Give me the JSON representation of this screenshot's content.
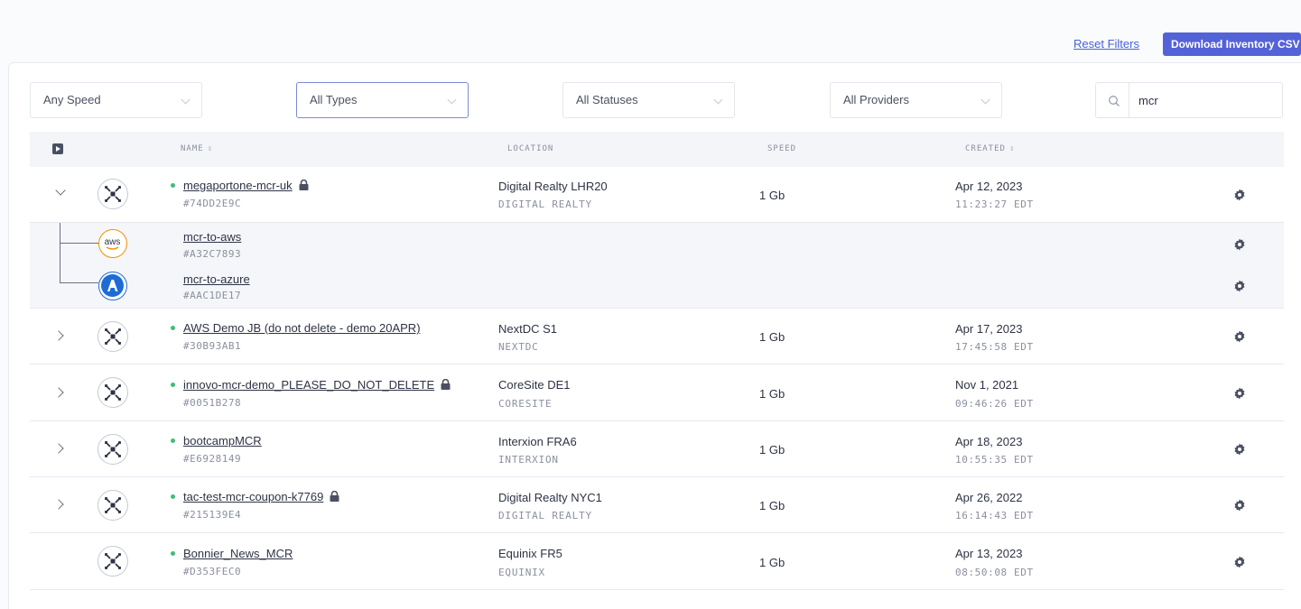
{
  "toolbar": {
    "reset_filters": "Reset Filters",
    "download_csv": "Download Inventory CSV"
  },
  "filters": {
    "speed": "Any Speed",
    "type": "All Types",
    "status": "All Statuses",
    "provider": "All Providers",
    "search_value": "mcr"
  },
  "table": {
    "headers": {
      "name": "NAME",
      "location": "LOCATION",
      "speed": "SPEED",
      "created": "CREATED"
    },
    "rows": [
      {
        "name": "megaportone-mcr-uk",
        "uid": "#74DD2E9C",
        "locked": true,
        "location": "Digital Realty LHR20",
        "provider": "DIGITAL REALTY",
        "speed": "1 Gb",
        "date": "Apr 12, 2023",
        "time": "11:23:27 EDT",
        "expanded": true,
        "children": [
          {
            "name": "mcr-to-aws",
            "uid": "#A32C7893",
            "icon": "aws-icon"
          },
          {
            "name": "mcr-to-azure",
            "uid": "#AAC1DE17",
            "icon": "azure-icon"
          }
        ]
      },
      {
        "name": "AWS Demo JB (do not delete - demo 20APR)",
        "uid": "#30B93AB1",
        "locked": false,
        "location": "NextDC S1",
        "provider": "NEXTDC",
        "speed": "1 Gb",
        "date": "Apr 17, 2023",
        "time": "17:45:58 EDT"
      },
      {
        "name": "innovo-mcr-demo_PLEASE_DO_NOT_DELETE",
        "uid": "#0051B278",
        "locked": true,
        "location": "CoreSite DE1",
        "provider": "CORESITE",
        "speed": "1 Gb",
        "date": "Nov 1, 2021",
        "time": "09:46:26 EDT"
      },
      {
        "name": "bootcampMCR",
        "uid": "#E6928149",
        "locked": false,
        "location": "Interxion FRA6",
        "provider": "INTERXION",
        "speed": "1 Gb",
        "date": "Apr 18, 2023",
        "time": "10:55:35 EDT"
      },
      {
        "name": "tac-test-mcr-coupon-k7769",
        "uid": "#215139E4",
        "locked": true,
        "location": "Digital Realty NYC1",
        "provider": "DIGITAL REALTY",
        "speed": "1 Gb",
        "date": "Apr 26, 2022",
        "time": "16:14:43 EDT"
      },
      {
        "name": "Bonnier_News_MCR",
        "uid": "#D353FEC0",
        "locked": false,
        "location": "Equinix FR5",
        "provider": "EQUINIX",
        "speed": "1 Gb",
        "date": "Apr 13, 2023",
        "time": "08:50:08 EDT"
      }
    ]
  },
  "icons": {
    "mcr": "mcr-icon",
    "gear": "gear-icon",
    "lock": "lock-icon",
    "chevron": "chevron-icon",
    "search": "search-icon"
  },
  "colors": {
    "accent": "#5462d8",
    "link": "#4862d8",
    "status_ok": "#3ebd7c",
    "aws_orange": "#f29100",
    "azure_blue": "#1e6bd6"
  }
}
